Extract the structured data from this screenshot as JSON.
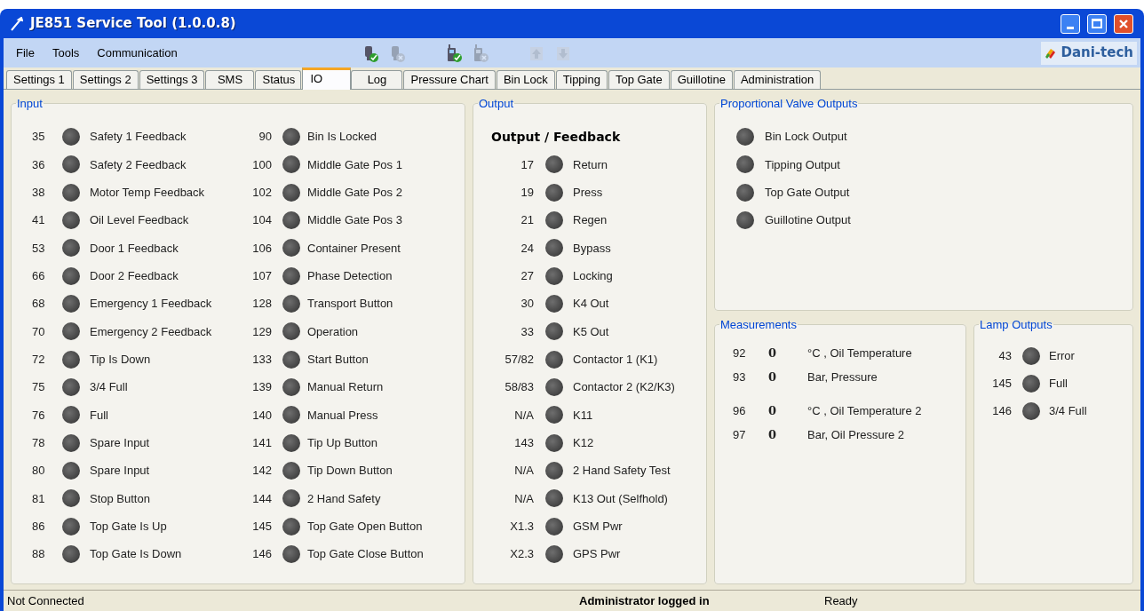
{
  "window": {
    "title": "JE851 Service Tool (1.0.0.8)"
  },
  "menu": [
    "File",
    "Tools",
    "Communication"
  ],
  "toolbar": [
    {
      "kind": "connect",
      "disabled": false
    },
    {
      "kind": "disconnect",
      "disabled": true
    },
    {
      "kind": "phone-connect",
      "disabled": false
    },
    {
      "kind": "phone-disconnect",
      "disabled": true
    },
    {
      "kind": "upload",
      "disabled": true
    },
    {
      "kind": "download",
      "disabled": true
    }
  ],
  "brand": "Dani-tech",
  "tabs": [
    {
      "label": "Settings 1",
      "selected": false
    },
    {
      "label": "Settings 2",
      "selected": false
    },
    {
      "label": "Settings 3",
      "selected": false
    },
    {
      "label": "SMS",
      "selected": false
    },
    {
      "label": "Status",
      "selected": false
    },
    {
      "label": "IO",
      "selected": true
    },
    {
      "label": "Log",
      "selected": false
    },
    {
      "label": "Pressure Chart",
      "selected": false
    },
    {
      "label": "Bin Lock",
      "selected": false
    },
    {
      "label": "Tipping",
      "selected": false
    },
    {
      "label": "Top Gate",
      "selected": false
    },
    {
      "label": "Guillotine",
      "selected": false
    },
    {
      "label": "Administration",
      "selected": false
    }
  ],
  "input": {
    "title": "Input",
    "columns": [
      [
        {
          "id": "35",
          "label": "Safety 1 Feedback",
          "on": false
        },
        {
          "id": "36",
          "label": "Safety 2 Feedback",
          "on": false
        },
        {
          "id": "38",
          "label": "Motor Temp Feedback",
          "on": false
        },
        {
          "id": "41",
          "label": "Oil Level Feedback",
          "on": false
        },
        {
          "id": "53",
          "label": "Door 1 Feedback",
          "on": false
        },
        {
          "id": "66",
          "label": "Door 2 Feedback",
          "on": false
        },
        {
          "id": "68",
          "label": "Emergency 1 Feedback",
          "on": false
        },
        {
          "id": "70",
          "label": "Emergency 2 Feedback",
          "on": false
        },
        {
          "id": "72",
          "label": "Tip Is Down",
          "on": false
        },
        {
          "id": "75",
          "label": "3/4 Full",
          "on": false
        },
        {
          "id": "76",
          "label": "Full",
          "on": false
        },
        {
          "id": "78",
          "label": "Spare Input",
          "on": false
        },
        {
          "id": "80",
          "label": "Spare Input",
          "on": false
        },
        {
          "id": "81",
          "label": "Stop Button",
          "on": false
        },
        {
          "id": "86",
          "label": "Top Gate Is Up",
          "on": false
        },
        {
          "id": "88",
          "label": "Top Gate Is Down",
          "on": false
        }
      ],
      [
        {
          "id": "90",
          "label": "Bin Is Locked",
          "on": false
        },
        {
          "id": "100",
          "label": "Middle Gate Pos 1",
          "on": false
        },
        {
          "id": "102",
          "label": "Middle Gate Pos 2",
          "on": false
        },
        {
          "id": "104",
          "label": "Middle Gate Pos 3",
          "on": false
        },
        {
          "id": "106",
          "label": "Container Present",
          "on": false
        },
        {
          "id": "107",
          "label": "Phase Detection",
          "on": false
        },
        {
          "id": "128",
          "label": "Transport Button",
          "on": false
        },
        {
          "id": "129",
          "label": "Operation",
          "on": false
        },
        {
          "id": "133",
          "label": "Start Button",
          "on": false
        },
        {
          "id": "139",
          "label": "Manual Return",
          "on": false
        },
        {
          "id": "140",
          "label": "Manual Press",
          "on": false
        },
        {
          "id": "141",
          "label": "Tip Up Button",
          "on": false
        },
        {
          "id": "142",
          "label": "Tip Down Button",
          "on": false
        },
        {
          "id": "144",
          "label": "2 Hand Safety",
          "on": false
        },
        {
          "id": "145",
          "label": "Top Gate Open Button",
          "on": false
        },
        {
          "id": "146",
          "label": "Top Gate Close Button",
          "on": false
        }
      ]
    ]
  },
  "output": {
    "title": "Output",
    "heading": "Output / Feedback",
    "rows": [
      {
        "id": "17",
        "label": "Return",
        "on": false
      },
      {
        "id": "19",
        "label": "Press",
        "on": false
      },
      {
        "id": "21",
        "label": "Regen",
        "on": false
      },
      {
        "id": "24",
        "label": "Bypass",
        "on": false
      },
      {
        "id": "27",
        "label": "Locking",
        "on": false
      },
      {
        "id": "30",
        "label": "K4 Out",
        "on": false
      },
      {
        "id": "33",
        "label": "K5 Out",
        "on": false
      },
      {
        "id": "57/82",
        "label": "Contactor 1 (K1)",
        "on": false
      },
      {
        "id": "58/83",
        "label": "Contactor 2 (K2/K3)",
        "on": false
      },
      {
        "id": "N/A",
        "label": "K11",
        "on": false
      },
      {
        "id": "143",
        "label": "K12",
        "on": false
      },
      {
        "id": "N/A",
        "label": "2 Hand Safety Test",
        "on": false
      },
      {
        "id": "N/A",
        "label": "K13 Out (Selfhold)",
        "on": false
      },
      {
        "id": "X1.3",
        "label": "GSM Pwr",
        "on": false
      },
      {
        "id": "X2.3",
        "label": "GPS Pwr",
        "on": false
      }
    ]
  },
  "proportional_valve_outputs": {
    "title": "Proportional Valve Outputs",
    "rows": [
      {
        "label": "Bin Lock Output",
        "on": false
      },
      {
        "label": "Tipping Output",
        "on": false
      },
      {
        "label": "Top Gate Output",
        "on": false
      },
      {
        "label": "Guillotine Output",
        "on": false
      }
    ]
  },
  "measurements": {
    "title": "Measurements",
    "rows": [
      {
        "id": "92",
        "value": "0",
        "unit": "°C , Oil Temperature"
      },
      {
        "id": "93",
        "value": "0",
        "unit": "Bar, Pressure"
      },
      {
        "id": "96",
        "value": "0",
        "unit": "°C , Oil Temperature 2"
      },
      {
        "id": "97",
        "value": "0",
        "unit": "Bar, Oil Pressure 2"
      }
    ]
  },
  "lamp_outputs": {
    "title": "Lamp Outputs",
    "rows": [
      {
        "id": "43",
        "label": "Error",
        "on": false
      },
      {
        "id": "145",
        "label": "Full",
        "on": false
      },
      {
        "id": "146",
        "label": "3/4 Full",
        "on": false
      }
    ]
  },
  "status_bar": {
    "connection": "Not Connected",
    "user": "Administrator logged in",
    "state": "Ready"
  }
}
